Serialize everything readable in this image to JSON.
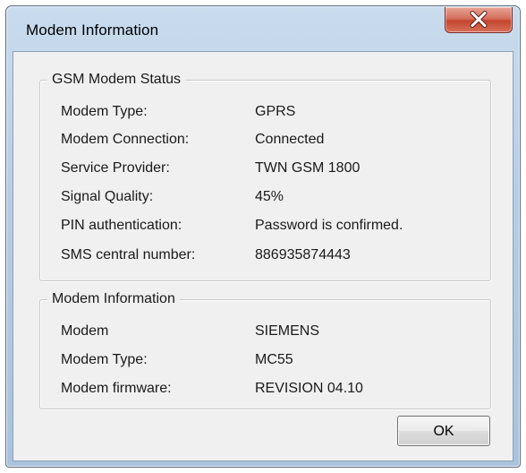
{
  "window": {
    "title": "Modem Information"
  },
  "gsm_status": {
    "title": "GSM Modem Status",
    "rows": [
      {
        "label": "Modem Type:",
        "value": "GPRS"
      },
      {
        "label": "Modem Connection:",
        "value": "Connected"
      },
      {
        "label": "Service Provider:",
        "value": "TWN GSM 1800"
      },
      {
        "label": "Signal Quality:",
        "value": "45%"
      },
      {
        "label": "PIN authentication:",
        "value": "Password is confirmed."
      },
      {
        "label": "SMS central number:",
        "value": "886935874443"
      }
    ]
  },
  "modem_info": {
    "title": "Modem Information",
    "rows": [
      {
        "label": "Modem",
        "value": "SIEMENS"
      },
      {
        "label": "Modem Type:",
        "value": "MC55"
      },
      {
        "label": "Modem firmware:",
        "value": "REVISION 04.10"
      }
    ]
  },
  "buttons": {
    "ok_label": "OK"
  },
  "icons": {
    "close": "close-icon"
  },
  "colors": {
    "close_button": "#c4452e",
    "title_bar": "#b7cde4",
    "client_background": "#f0f0f0"
  }
}
